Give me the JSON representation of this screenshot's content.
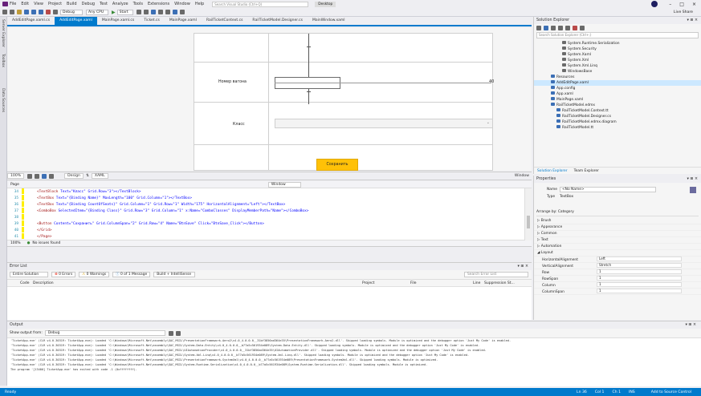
{
  "menu": {
    "items": [
      "File",
      "Edit",
      "View",
      "Project",
      "Build",
      "Debug",
      "Test",
      "Analyze",
      "Tools",
      "Extensions",
      "Window",
      "Help"
    ],
    "search_placeholder": "Search Visual Studio (Ctrl+Q)",
    "title": "Desktop",
    "live_share": "Live Share"
  },
  "toolbar": {
    "config": "Debug",
    "platform": "Any CPU",
    "start": "Start"
  },
  "left_rail": [
    "Server Explorer",
    "Toolbox",
    "Data Sources"
  ],
  "doc_tabs": [
    {
      "label": "AddEditPage.xaml.cs",
      "active": false
    },
    {
      "label": "AddEditPage.xaml",
      "active": true
    },
    {
      "label": "MainPage.xaml.cs",
      "active": false
    },
    {
      "label": "Ticket.cs",
      "active": false
    },
    {
      "label": "MainPage.xaml",
      "active": false
    },
    {
      "label": "RailTicketContext.cs",
      "active": false
    },
    {
      "label": "RailTicketModel.Designer.cs",
      "active": false
    },
    {
      "label": "MainWindow.xaml",
      "active": false
    }
  ],
  "designer": {
    "label_number": "Номер вагона",
    "label_type": "Класс",
    "save_button": "Сохранить",
    "margin_value": "40"
  },
  "split": {
    "zoom": "100%",
    "tab_design": "Design",
    "tab_xaml": "XAML",
    "element": "Window",
    "page_element": "Page"
  },
  "xaml": {
    "lines": [
      {
        "num": "34",
        "tag": "<TextBlock",
        "attrs": " Text=\"Класс\" Grid.Row=\"3\"></TextBlock>"
      },
      {
        "num": "35",
        "tag": "<TextBox",
        "attrs": " Text=\"{Binding Name}\" MaxLength=\"100\" Grid.Column=\"1\"></TextBox>"
      },
      {
        "num": "36",
        "tag": "<TextBox",
        "attrs": " Text=\"{Binding CountOfSeats}\" Grid.Column=\"1\" Grid.Row=\"1\" Width=\"175\" HorizontalAlignment=\"Left\"></TextBox>"
      },
      {
        "num": "37",
        "tag": "<ComboBox",
        "attrs": " SelectedItem=\"{Binding Class}\" Grid.Row=\"3\" Grid.Column=\"1\" x:Name=\"ComboClasses\" DisplayMemberPath=\"Name\"></ComboBox>"
      },
      {
        "num": "38",
        "tag": "",
        "attrs": ""
      },
      {
        "num": "39",
        "tag": "<Button",
        "attrs": " Content=\"Сохранить\" Grid.ColumnSpan=\"2\" Grid.Row=\"4\" Name=\"BtnSave\" Click=\"BtnSave_Click\"></Button>"
      },
      {
        "num": "40",
        "tag": "</Grid>",
        "attrs": ""
      },
      {
        "num": "41",
        "tag": "</Page>",
        "attrs": ""
      }
    ],
    "zoom": "100%",
    "status": "No issues found"
  },
  "error_list": {
    "title": "Error List",
    "scope": "Entire Solution",
    "errors": "0 Errors",
    "warnings": "0 Warnings",
    "messages": "0 of 1 Message",
    "build": "Build + IntelliSense",
    "search_placeholder": "Search Error List",
    "columns": [
      "Code",
      "Description",
      "Project",
      "File",
      "Line",
      "Suppression St..."
    ]
  },
  "output": {
    "title": "Output",
    "show_from_label": "Show output from:",
    "show_from_value": "Debug",
    "lines": [
      "'TicketApp.exe' (CLR v4.0.30319: TicketApp.exe): Loaded 'C:\\Windows\\Microsoft.Net\\assembly\\GAC_MSIL\\PresentationFramework.Aero2\\v4.0_4.0.0.0__31bf3856ad364e35\\PresentationFramework.Aero2.dll'. Skipped loading symbols. Module is optimized and the debugger option 'Just My Code' is enabled.",
      "'TicketApp.exe' (CLR v4.0.30319: TicketApp.exe): Loaded 'C:\\Windows\\Microsoft.Net\\assembly\\GAC_MSIL\\System.Data.Entity\\v4.0_4.0.0.0__b77a5c561934e089\\System.Data.Entity.dll'. Skipped loading symbols. Module is optimized and the debugger option 'Just My Code' is enabled.",
      "'TicketApp.exe' (CLR v4.0.30319: TicketApp.exe): Loaded 'C:\\Windows\\Microsoft.Net\\assembly\\GAC_MSIL\\UIAutomationProvider\\v4.0_4.0.0.0__31bf3856ad364e35\\UIAutomationProvider.dll'. Skipped loading symbols. Module is optimized and the debugger option 'Just My Code' is enabled.",
      "'TicketApp.exe' (CLR v4.0.30319: TicketApp.exe): Loaded 'C:\\Windows\\Microsoft.Net\\assembly\\GAC_MSIL\\System.Xml.Linq\\v4.0_4.0.0.0__b77a5c561934e089\\System.Xml.Linq.dll'. Skipped loading symbols. Module is optimized and the debugger option 'Just My Code' is enabled.",
      "'TicketApp.exe' (CLR v4.0.30319: TicketApp.exe): Loaded 'C:\\Windows\\Microsoft.Net\\assembly\\GAC_MSIL\\PresentationFramework-SystemXml\\v4.0_4.0.0.0__b77a5c561934e089\\PresentationFramework-SystemXml.dll'. Skipped loading symbols. Module is optimized.",
      "'TicketApp.exe' (CLR v4.0.30319: TicketApp.exe): Loaded 'C:\\Windows\\Microsoft.Net\\assembly\\GAC_MSIL\\System.Runtime.Serialization\\v4.0_4.0.0.0__b77a5c561934e089\\System.Runtime.Serialization.dll'. Skipped loading symbols. Module is optimized.",
      "The program '[13400] TicketApp.exe' has exited with code -1 (0xffffffff)."
    ]
  },
  "solution": {
    "title": "Solution Explorer",
    "search_placeholder": "Search Solution Explorer (Ctrl+;)",
    "items": [
      {
        "label": "System.Runtime.Serialization",
        "indent": 5,
        "sel": false
      },
      {
        "label": "System.Security",
        "indent": 5,
        "sel": false
      },
      {
        "label": "System.Xaml",
        "indent": 5,
        "sel": false
      },
      {
        "label": "System.Xml",
        "indent": 5,
        "sel": false
      },
      {
        "label": "System.Xml.Linq",
        "indent": 5,
        "sel": false
      },
      {
        "label": "WindowsBase",
        "indent": 5,
        "sel": false
      },
      {
        "label": "Resources",
        "indent": 3,
        "sel": false
      },
      {
        "label": "AddEditPage.xaml",
        "indent": 3,
        "sel": true
      },
      {
        "label": "App.config",
        "indent": 3,
        "sel": false
      },
      {
        "label": "App.xaml",
        "indent": 3,
        "sel": false
      },
      {
        "label": "MainPage.xaml",
        "indent": 3,
        "sel": false
      },
      {
        "label": "RailTicketModel.edmx",
        "indent": 3,
        "sel": false
      },
      {
        "label": "RailTicketModel.Context.tt",
        "indent": 4,
        "sel": false
      },
      {
        "label": "RailTicketModel.Designer.cs",
        "indent": 4,
        "sel": false
      },
      {
        "label": "RailTicketModel.edmx.diagram",
        "indent": 4,
        "sel": false
      },
      {
        "label": "RailTicketModel.tt",
        "indent": 4,
        "sel": false
      }
    ],
    "tab_solution": "Solution Explorer",
    "tab_team": "Team Explorer"
  },
  "properties": {
    "title": "Properties",
    "name_label": "Name",
    "name_value": "<No Name>",
    "type_label": "Type",
    "type_value": "TextBox",
    "arrange": "Arrange by: Category",
    "categories": [
      "Brush",
      "Appearance",
      "Common",
      "Text",
      "Automation",
      "Layout"
    ],
    "rows": [
      {
        "name": "HorizontalAlignment",
        "value": "Left"
      },
      {
        "name": "VerticalAlignment",
        "value": "Stretch"
      },
      {
        "name": "Row",
        "value": "1"
      },
      {
        "name": "RowSpan",
        "value": "1"
      },
      {
        "name": "Column",
        "value": "1"
      },
      {
        "name": "ColumnSpan",
        "value": "1"
      }
    ]
  },
  "status": {
    "text": "Ready",
    "items": [
      "Ln 36",
      "Col 1",
      "Ch 1",
      "INS"
    ],
    "source_control": "Add to Source Control"
  },
  "colors": {
    "accent": "#007acc",
    "button_yellow": "#ffc107",
    "selection": "#cce8ff"
  }
}
